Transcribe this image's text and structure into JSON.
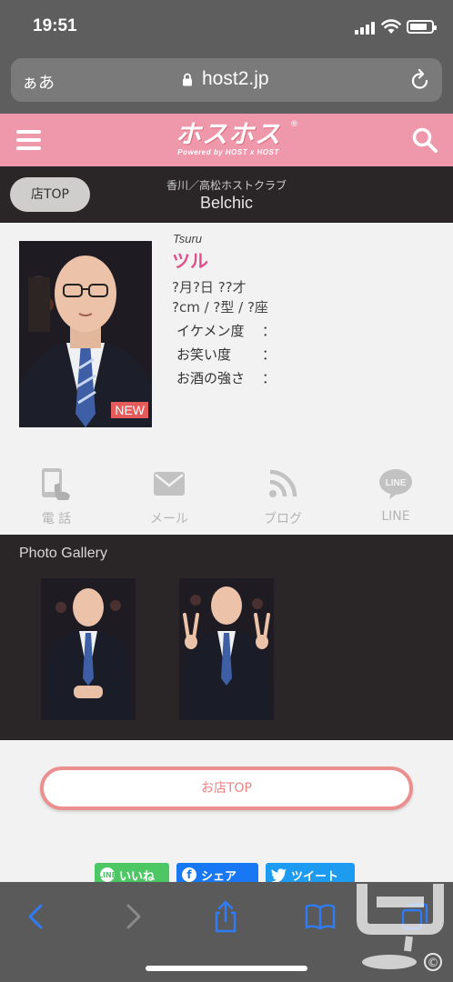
{
  "status": {
    "time": "19:51"
  },
  "browser": {
    "aa": "ぁあ",
    "url": "host2.jp"
  },
  "header": {
    "logo": "ホスホス",
    "logo_sub": "Powered by HOST x HOST",
    "logo_reg": "®"
  },
  "shop": {
    "top_button": "店TOP",
    "area": "香川／高松ホストクラブ",
    "name": "Belchic"
  },
  "profile": {
    "badge": "NEW",
    "name_roman": "Tsuru",
    "name_kana": "ツル",
    "birthday_age": "?月?日 ??才",
    "body": "?cm / ?型 / ?座",
    "stats": [
      {
        "label": "イケメン度",
        "colon": "："
      },
      {
        "label": "お笑い度",
        "colon": "："
      },
      {
        "label": "お酒の強さ",
        "colon": "："
      }
    ]
  },
  "contacts": [
    {
      "label": "電 話",
      "icon": "phone-icon"
    },
    {
      "label": "メール",
      "icon": "mail-icon"
    },
    {
      "label": "ブログ",
      "icon": "rss-icon"
    },
    {
      "label": "LINE",
      "icon": "line-icon"
    }
  ],
  "contact_line_text": "LINE",
  "gallery": {
    "title": "Photo Gallery"
  },
  "bottom": {
    "shop_top_button": "お店TOP"
  },
  "share": {
    "line": "いいね",
    "line_icon_text": "LINE",
    "facebook": "シェア",
    "twitter": "ツイート",
    "colors": {
      "line": "#4cc764",
      "facebook": "#1877f2",
      "twitter": "#1d9bf0"
    }
  },
  "watermark": {
    "copyright": "©"
  },
  "colors": {
    "header_pink": "#ef97ab",
    "dark_band": "#2a2527",
    "name_pink": "#e0508a",
    "button_outline": "#ec8f8f"
  }
}
